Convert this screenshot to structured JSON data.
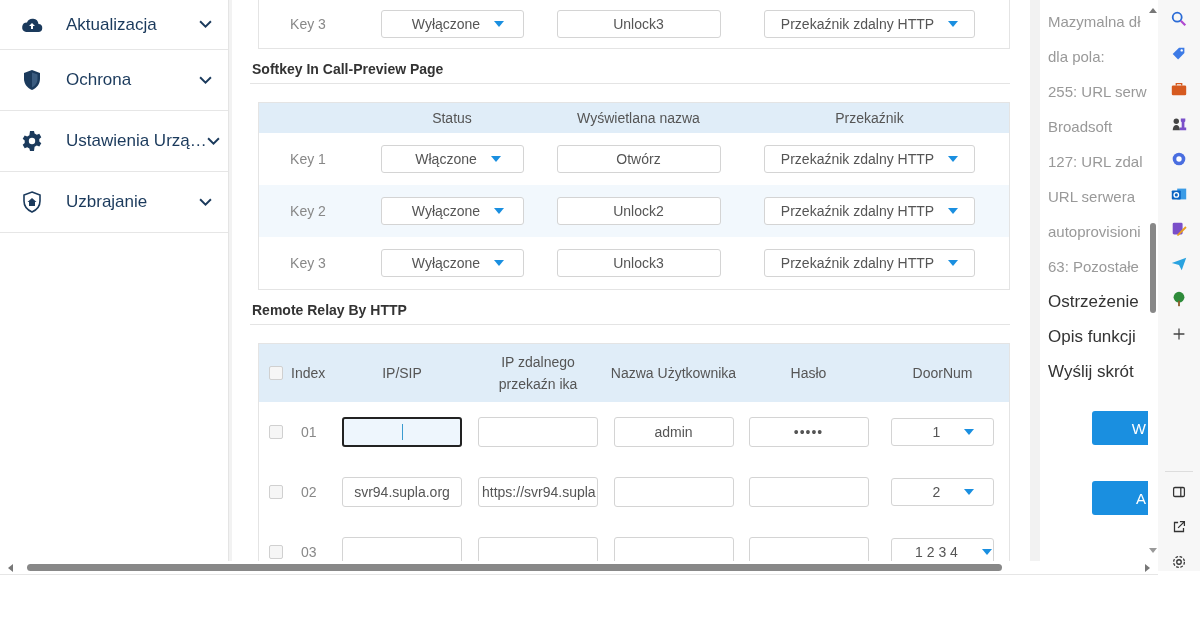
{
  "sidebar": {
    "items": [
      {
        "label": "Aktualizacja",
        "expanded": false
      },
      {
        "label": "Ochrona",
        "expanded": false
      },
      {
        "label": "Ustawienia Urzą…",
        "expanded": false
      },
      {
        "label": "Uzbrajanie",
        "expanded": false
      }
    ]
  },
  "previous_table": {
    "rows": [
      {
        "key": "Key 3",
        "status": "Wyłączone",
        "name": "Unlock3",
        "relay": "Przekaźnik zdalny HTTP"
      }
    ]
  },
  "softkey_section": {
    "title": "Softkey In Call-Preview Page",
    "columns": [
      "Status",
      "Wyświetlana nazwa",
      "Przekaźnik"
    ],
    "rows": [
      {
        "key": "Key 1",
        "status": "Włączone",
        "name": "Otwórz",
        "relay": "Przekaźnik zdalny HTTP"
      },
      {
        "key": "Key 2",
        "status": "Wyłączone",
        "name": "Unlock2",
        "relay": "Przekaźnik zdalny HTTP"
      },
      {
        "key": "Key 3",
        "status": "Wyłączone",
        "name": "Unlock3",
        "relay": "Przekaźnik zdalny HTTP"
      }
    ]
  },
  "relay_section": {
    "title": "Remote Relay By HTTP",
    "select_all_checked": false,
    "columns": [
      "Index",
      "IP/SIP",
      "IP zdalnego przekaźn ika",
      "Nazwa Użytkownika",
      "Hasło",
      "DoorNum"
    ],
    "rows": [
      {
        "index": "01",
        "checked": false,
        "ip_sip": "",
        "ip_sip_focused": true,
        "remote_ip": "",
        "username": "admin",
        "password": "•••••",
        "door_num": "1"
      },
      {
        "index": "02",
        "checked": false,
        "ip_sip": "svr94.supla.org",
        "ip_sip_focused": false,
        "remote_ip": "https://svr94.supla",
        "username": "",
        "password": "",
        "door_num": "2"
      },
      {
        "index": "03",
        "checked": false,
        "ip_sip": "",
        "ip_sip_focused": false,
        "remote_ip": "",
        "username": "",
        "password": "",
        "door_num": "1 2 3 4"
      }
    ]
  },
  "help_panel": {
    "lines": [
      {
        "text": "Mazymalna dł",
        "kind": "note"
      },
      {
        "text": "dla pola:",
        "kind": "note"
      },
      {
        "text": "255: URL serw",
        "kind": "note"
      },
      {
        "text": "Broadsoft",
        "kind": "note"
      },
      {
        "text": "127: URL zdal",
        "kind": "note"
      },
      {
        "text": "URL serwera",
        "kind": "note"
      },
      {
        "text": "autoprovisioni",
        "kind": "note"
      },
      {
        "text": "63: Pozostałe",
        "kind": "note"
      },
      {
        "text": "Ostrzeżenie",
        "kind": "heading"
      },
      {
        "text": "Opis funkcji",
        "kind": "heading"
      },
      {
        "text": "Wyślij skrót",
        "kind": "heading"
      }
    ],
    "buttons": [
      "W",
      "A"
    ]
  }
}
